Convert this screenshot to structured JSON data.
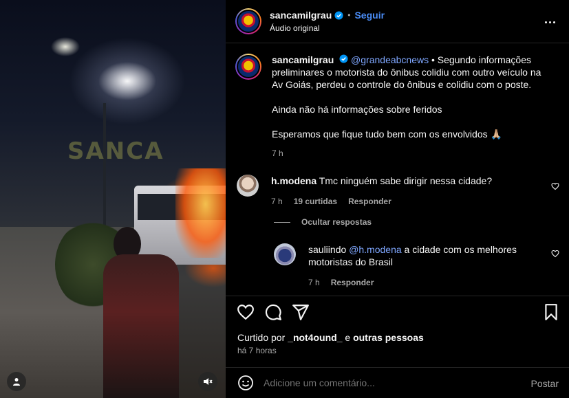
{
  "video": {
    "watermark": "SANCA",
    "user_icon": "user-icon",
    "mute_icon": "speaker-muted-icon"
  },
  "header": {
    "username": "sancamilgrau",
    "separator": "•",
    "follow_label": "Seguir",
    "audio_label": "Áudio original",
    "more_icon": "more-horizontal-icon"
  },
  "caption": {
    "username": "sancamilgrau",
    "mention": "@grandeabcnews",
    "text1": " • Segundo informações preliminares o motorista do ônibus colidiu com outro veículo na Av Goiás, perdeu o controle do ônibus e colidiu com o poste.",
    "text2": "Ainda não há informações sobre feridos",
    "text3": "Esperamos que fique tudo bem com os envolvidos 🙏🏼",
    "time": "7 h"
  },
  "comments": [
    {
      "username": "h.modena",
      "text": " Tmc ninguém sabe dirigir nessa cidade?",
      "time": "7 h",
      "likes": "19 curtidas",
      "reply_label": "Responder"
    }
  ],
  "hide_replies_label": "Ocultar respostas",
  "replies": [
    {
      "username": "sauliindo",
      "mention": "@h.modena",
      "text": " a cidade com os melhores motoristas do Brasil",
      "time": "7 h",
      "reply_label": "Responder"
    }
  ],
  "actions": {
    "like_icon": "heart-icon",
    "comment_icon": "comment-icon",
    "share_icon": "send-icon",
    "save_icon": "bookmark-icon"
  },
  "likes": {
    "prefix": "Curtido por ",
    "user": "_not4ound_",
    "middle": " e ",
    "others": "outras pessoas"
  },
  "posted_ago": "há 7 horas",
  "add_comment": {
    "emoji_icon": "emoji-icon",
    "placeholder": "Adicione um comentário...",
    "post_label": "Postar"
  },
  "colors": {
    "accent": "#4a8cf5",
    "mention": "#7fa7ff",
    "muted": "#a8a8a8",
    "background": "#000000"
  }
}
